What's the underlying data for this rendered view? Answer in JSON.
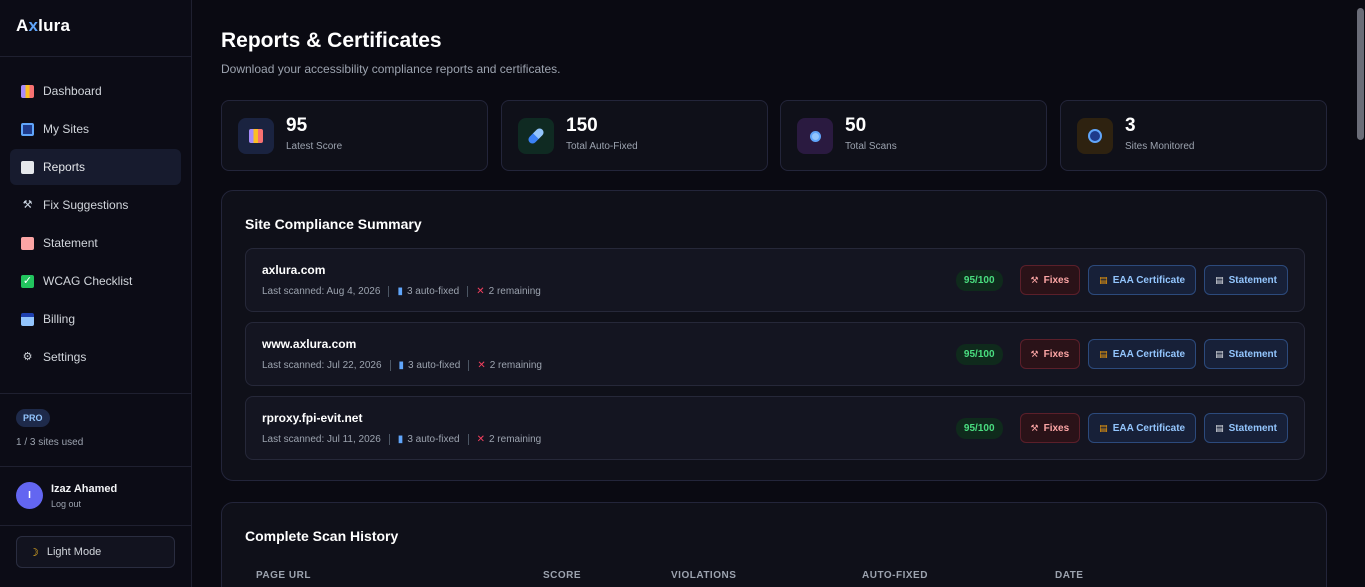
{
  "brand": {
    "prefix": "A",
    "x": "x",
    "suffix": "lura"
  },
  "sidebar": {
    "items": [
      {
        "label": "Dashboard"
      },
      {
        "label": "My Sites"
      },
      {
        "label": "Reports"
      },
      {
        "label": "Fix Suggestions"
      },
      {
        "label": "Statement"
      },
      {
        "label": "WCAG Checklist"
      },
      {
        "label": "Billing"
      },
      {
        "label": "Settings"
      }
    ],
    "plan_badge": "PRO",
    "sites_used": "1 / 3 sites used",
    "user": {
      "initial": "I",
      "name": "Izaz Ahamed",
      "logout": "Log out"
    },
    "light_mode": "Light Mode"
  },
  "page": {
    "title": "Reports & Certificates",
    "subtitle": "Download your accessibility compliance reports and certificates."
  },
  "stats": [
    {
      "value": "95",
      "label": "Latest Score",
      "icon": "bar-chart-icon"
    },
    {
      "value": "150",
      "label": "Total Auto-Fixed",
      "icon": "pill-icon"
    },
    {
      "value": "50",
      "label": "Total Scans",
      "icon": "magnifier-icon"
    },
    {
      "value": "3",
      "label": "Sites Monitored",
      "icon": "globe-icon"
    }
  ],
  "summary": {
    "title": "Site Compliance Summary",
    "sites": [
      {
        "name": "axlura.com",
        "last_scanned": "Last scanned: Aug 4, 2026",
        "auto_fixed": "3 auto-fixed",
        "remaining": "2 remaining",
        "score": "95/100"
      },
      {
        "name": "www.axlura.com",
        "last_scanned": "Last scanned: Jul 22, 2026",
        "auto_fixed": "3 auto-fixed",
        "remaining": "2 remaining",
        "score": "95/100"
      },
      {
        "name": "rproxy.fpi-evit.net",
        "last_scanned": "Last scanned: Jul 11, 2026",
        "auto_fixed": "3 auto-fixed",
        "remaining": "2 remaining",
        "score": "95/100"
      }
    ],
    "buttons": {
      "fixes": "Fixes",
      "certificate": "EAA Certificate",
      "statement": "Statement"
    }
  },
  "history": {
    "title": "Complete Scan History",
    "columns": [
      "PAGE URL",
      "SCORE",
      "VIOLATIONS",
      "AUTO-FIXED",
      "DATE"
    ]
  },
  "colors": {
    "accent": "#60a5fa",
    "success": "#4ade80",
    "danger": "#fca5a5",
    "background": "#0a0a12"
  }
}
